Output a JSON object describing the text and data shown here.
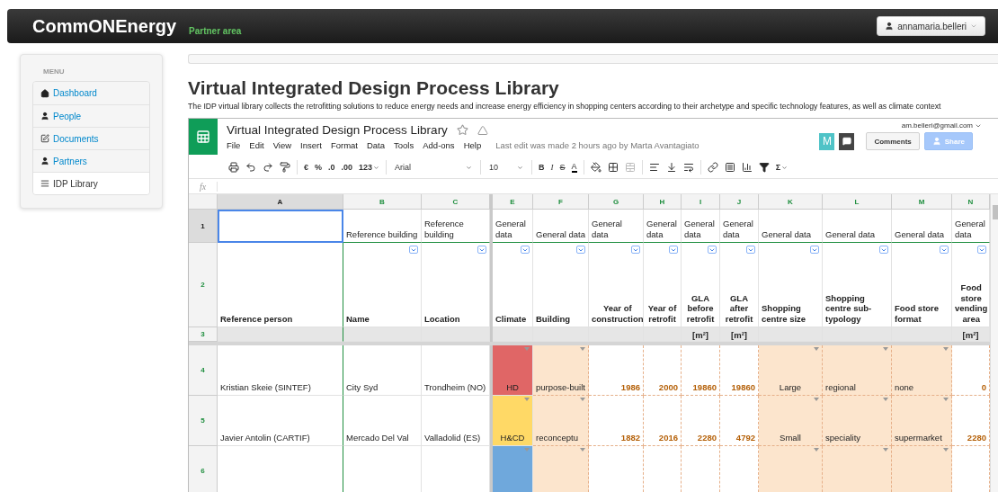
{
  "topbar": {
    "brand": "CommONEnergy",
    "subtitle": "Partner area",
    "user": "annamaria.belleri"
  },
  "sidebar": {
    "heading": "MENU",
    "items": [
      {
        "label": "Dashboard",
        "selected": false
      },
      {
        "label": "People",
        "selected": false
      },
      {
        "label": "Documents",
        "selected": false
      },
      {
        "label": "Partners",
        "selected": false
      },
      {
        "label": "IDP Library",
        "selected": true
      }
    ]
  },
  "page": {
    "title": "Virtual Integrated Design Process Library",
    "description": "The IDP virtual library collects the retrofitting solutions to reduce energy needs and increase energy efficiency in shopping centers according to their archetype and specific technology features, as well as climate context"
  },
  "spreadsheet": {
    "title": "Virtual Integrated Design Process Library",
    "menu": [
      "File",
      "Edit",
      "View",
      "Insert",
      "Format",
      "Data",
      "Tools",
      "Add-ons",
      "Help"
    ],
    "last_edit": "Last edit was made 2 hours ago by Marta Avantagiato",
    "account": "am.belleri@gmail.com",
    "avatar": "M",
    "comments_button": "Comments",
    "share_button": "Share",
    "toolbar": {
      "currency": "€",
      "percent": "%",
      "decrease_decimals": ".0",
      "increase_decimals": ".00",
      "number_format": "123",
      "font": "Arial",
      "font_size": "10",
      "bold": "B",
      "italic": "I",
      "strikethrough": "S",
      "text_color": "A",
      "functions": "Σ"
    },
    "formula_label": "fx",
    "columns": [
      {
        "letter": "A",
        "selected": true,
        "filter": false,
        "kind": "text"
      },
      {
        "letter": "B",
        "selected": false,
        "filter": true,
        "kind": "text"
      },
      {
        "letter": "C",
        "selected": false,
        "filter": true,
        "kind": "text"
      },
      {
        "letter": "E",
        "selected": false,
        "filter": true,
        "kind": "climate"
      },
      {
        "letter": "F",
        "selected": false,
        "filter": true,
        "kind": "choice"
      },
      {
        "letter": "G",
        "selected": false,
        "filter": true,
        "kind": "number"
      },
      {
        "letter": "H",
        "selected": false,
        "filter": true,
        "kind": "number"
      },
      {
        "letter": "I",
        "selected": false,
        "filter": true,
        "kind": "number"
      },
      {
        "letter": "J",
        "selected": false,
        "filter": true,
        "kind": "number"
      },
      {
        "letter": "K",
        "selected": false,
        "filter": true,
        "kind": "category"
      },
      {
        "letter": "L",
        "selected": false,
        "filter": true,
        "kind": "choice"
      },
      {
        "letter": "M",
        "selected": false,
        "filter": true,
        "kind": "choice"
      },
      {
        "letter": "N",
        "selected": false,
        "filter": true,
        "kind": "number"
      }
    ],
    "rows": [
      {
        "number": "1",
        "selected": true,
        "kind": "group",
        "cells": [
          {},
          {
            "text": "Reference building"
          },
          {
            "text": "Reference building"
          },
          {
            "text": "General data"
          },
          {
            "text": "General data"
          },
          {
            "text": "General data"
          },
          {
            "text": "General data"
          },
          {
            "text": "General data"
          },
          {
            "text": "General data"
          },
          {
            "text": "General data"
          },
          {
            "text": "General data"
          },
          {
            "text": "General data"
          },
          {
            "text": "General data"
          }
        ]
      },
      {
        "number": "2",
        "selected": false,
        "kind": "field",
        "cells": [
          {
            "text": "Reference person"
          },
          {
            "text": "Name"
          },
          {
            "text": "Location"
          },
          {
            "text": "Climate"
          },
          {
            "text": "Building"
          },
          {
            "text": "Year of construction"
          },
          {
            "text": "Year of retrofit"
          },
          {
            "text": "GLA before retrofit"
          },
          {
            "text": "GLA after retrofit"
          },
          {
            "text": "Shopping centre size"
          },
          {
            "text": "Shopping centre sub-typology"
          },
          {
            "text": "Food store format"
          },
          {
            "text": "Food store vending area"
          }
        ]
      },
      {
        "number": "3",
        "selected": false,
        "kind": "unit",
        "cells": [
          {},
          {},
          {},
          {},
          {},
          {},
          {},
          {
            "text": "[m²]"
          },
          {
            "text": "[m²]"
          },
          {},
          {},
          {},
          {
            "text": "[m²]"
          }
        ]
      },
      {
        "number": "4",
        "selected": false,
        "kind": "data",
        "cells": [
          {
            "text": "Kristian Skeie (SINTEF)"
          },
          {
            "text": "City Syd"
          },
          {
            "text": "Trondheim (NO)"
          },
          {
            "text": "HD",
            "color": "#e06666"
          },
          {
            "text": "purpose-built"
          },
          {
            "text": "1986"
          },
          {
            "text": "2000"
          },
          {
            "text": "19860"
          },
          {
            "text": "19860"
          },
          {
            "text": "Large"
          },
          {
            "text": "regional"
          },
          {
            "text": "none"
          },
          {
            "text": "0"
          }
        ]
      },
      {
        "number": "5",
        "selected": false,
        "kind": "data",
        "cells": [
          {
            "text": "Javier Antolin (CARTIF)"
          },
          {
            "text": "Mercado Del Val"
          },
          {
            "text": "Valladolid (ES)"
          },
          {
            "text": "H&CD",
            "color": "#ffd966"
          },
          {
            "text": "reconceptu"
          },
          {
            "text": "1882"
          },
          {
            "text": "2016"
          },
          {
            "text": "2280"
          },
          {
            "text": "4792"
          },
          {
            "text": "Small"
          },
          {
            "text": "speciality"
          },
          {
            "text": "supermarket"
          },
          {
            "text": "2280"
          }
        ]
      },
      {
        "number": "6",
        "selected": false,
        "kind": "data",
        "cells": [
          {},
          {},
          {},
          {
            "color": "#6fa8dc"
          },
          {},
          {},
          {},
          {},
          {},
          {},
          {},
          {},
          {}
        ]
      }
    ]
  }
}
